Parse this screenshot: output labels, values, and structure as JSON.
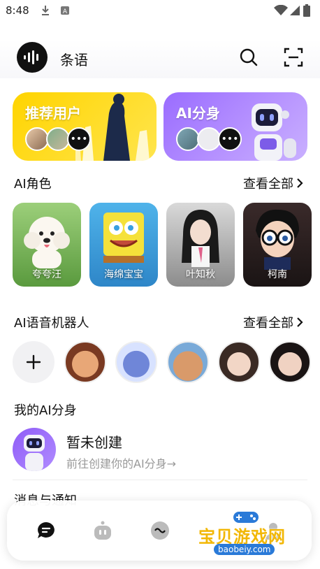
{
  "status_bar": {
    "time": "8:48"
  },
  "header": {
    "app_name": "条语"
  },
  "hero": {
    "recommended_users": {
      "title": "推荐用户"
    },
    "ai_clone": {
      "title": "AI分身"
    }
  },
  "ai_roles": {
    "title": "AI角色",
    "view_all": "查看全部",
    "items": [
      {
        "name": "夸夸汪"
      },
      {
        "name": "海绵宝宝"
      },
      {
        "name": "叶知秋"
      },
      {
        "name": "柯南"
      }
    ]
  },
  "voice_robots": {
    "title": "AI语音机器人",
    "view_all": "查看全部"
  },
  "my_clone": {
    "title": "我的AI分身",
    "status": "暂未创建",
    "subtitle": "前往创建你的AI分身→"
  },
  "notices": {
    "title": "消息与通知"
  },
  "watermark": {
    "text": "宝贝游戏网",
    "url": "baobeiy.com"
  },
  "colors": {
    "accent_purple": "#9a6cff",
    "accent_yellow": "#ffd400"
  }
}
